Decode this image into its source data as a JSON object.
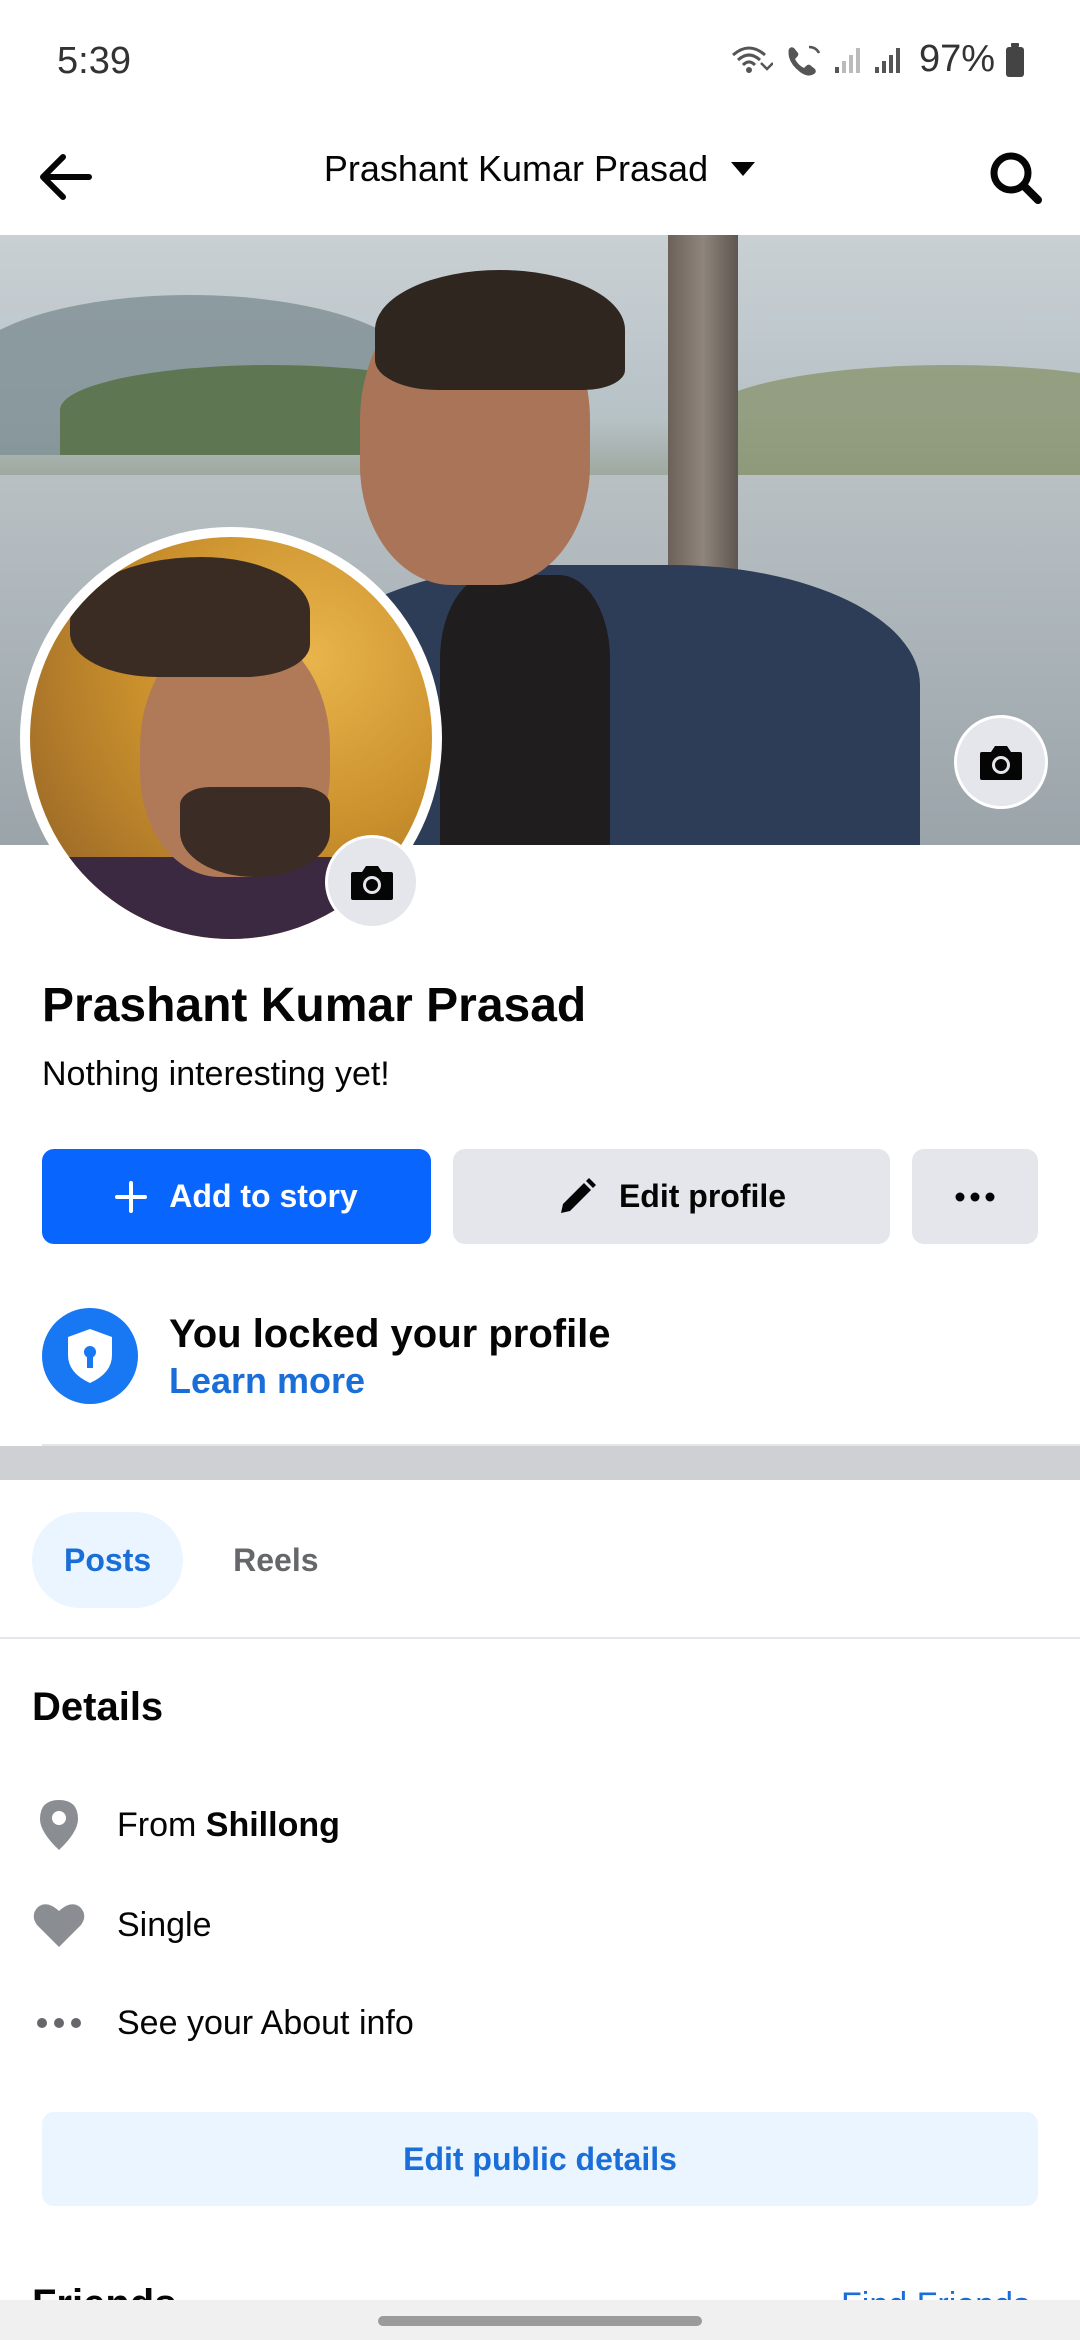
{
  "status_bar": {
    "time": "5:39",
    "battery": "97%",
    "icons": [
      "wifi-calling-icon",
      "wifi-call-icon",
      "signal-icon",
      "signal-icon",
      "battery-icon"
    ]
  },
  "header": {
    "title": "Prashant Kumar Prasad",
    "back_icon": "arrow-left-icon",
    "dropdown_icon": "caret-down-icon",
    "search_icon": "search-icon"
  },
  "profile": {
    "name": "Prashant Kumar Prasad",
    "bio": "Nothing interesting yet!",
    "cover_camera_icon": "camera-icon",
    "avatar_camera_icon": "camera-icon"
  },
  "actions": {
    "add_story": "Add to story",
    "edit_profile": "Edit profile",
    "more": "more-options"
  },
  "locked": {
    "title": "You locked your profile",
    "link": "Learn more"
  },
  "tabs": [
    {
      "label": "Posts",
      "active": true
    },
    {
      "label": "Reels",
      "active": false
    }
  ],
  "details": {
    "title": "Details",
    "from_prefix": "From",
    "from_place": "Shillong",
    "relationship": "Single",
    "about": "See your About info",
    "edit_button": "Edit public details"
  },
  "friends": {
    "title": "Friends",
    "find_link": "Find Friends"
  },
  "colors": {
    "primary": "#0866ff",
    "link": "#1a6ed8",
    "button_gray": "#e4e6eb",
    "tab_active_bg": "#ebf5ff",
    "icon_gray": "#8a8d91"
  }
}
